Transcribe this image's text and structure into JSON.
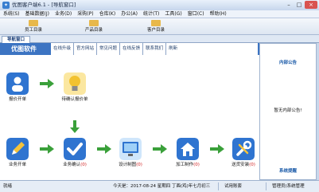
{
  "window": {
    "title": "优图客户端6.1 - [导航窗口]",
    "app_icon": "app-logo-icon"
  },
  "menu": [
    "系统(S)",
    "基础数据(J)",
    "业务(D)",
    "采购(P)",
    "仓库(K)",
    "办公(A)",
    "统计(T)",
    "工具(G)",
    "窗口(C)",
    "帮助(H)"
  ],
  "toolbar": [
    {
      "label": "员工目录",
      "icon": "staff-directory-icon",
      "color": "#e8b84a"
    },
    {
      "label": "产品目录",
      "icon": "product-directory-icon",
      "color": "#e8b84a"
    },
    {
      "label": "客户目录",
      "icon": "customer-directory-icon",
      "color": "#e8b84a"
    }
  ],
  "nav_tab": "导航窗口",
  "brand": "优图软件",
  "links": [
    "在线升级",
    "官方网站",
    "常见问题",
    "在线反馈",
    "联系我们",
    "刷新"
  ],
  "side": {
    "top_title": "内部公告",
    "message": "暂无内部公告!",
    "bottom_title": "系统提醒"
  },
  "flow": {
    "nodes": [
      {
        "label": "报价开单",
        "count": "",
        "icon": "person-quote-icon",
        "color": "#2f74d0"
      },
      {
        "label": "待确认报价单",
        "count": "",
        "icon": "lightbulb-icon",
        "color": "#f2c230"
      },
      {
        "label": "业务开单",
        "count": "",
        "icon": "pencil-icon",
        "color": "#2f74d0"
      },
      {
        "label": "业务确认",
        "count": "(0)",
        "icon": "checkmark-icon",
        "color": "#2f74d0"
      },
      {
        "label": "设计制图",
        "count": "(0)",
        "icon": "monitor-icon",
        "color": "#2f74d0"
      },
      {
        "label": "加工制作",
        "count": "(0)",
        "icon": "house-icon",
        "color": "#2f74d0"
      },
      {
        "label": "送货安装",
        "count": "(0)",
        "icon": "tools-icon",
        "color": "#2f74d0"
      }
    ]
  },
  "status": {
    "ready": "就绪",
    "date": "今天是：2017-08-24 星期四 丁酉(鸡)年七月初三",
    "version": "试用账套",
    "user": "管理员(系统管理"
  },
  "colors": {
    "accent": "#3c74c2",
    "arrow_green": "#3aa03a",
    "count_red": "#d02020"
  }
}
